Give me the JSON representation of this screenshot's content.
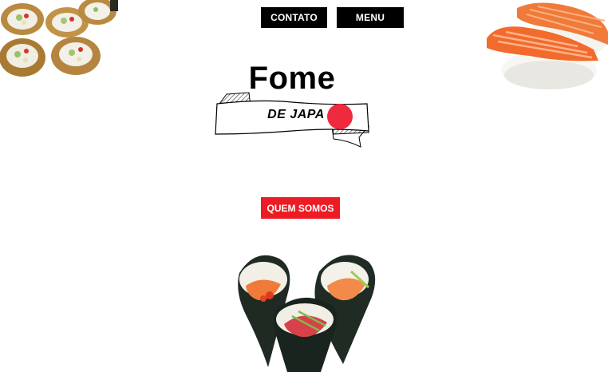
{
  "nav": {
    "contato_label": "CONTATO",
    "menu_label": "MENU"
  },
  "logo": {
    "title": "Fome",
    "subtitle": "DE JAPA"
  },
  "cta": {
    "quem_somos_label": "QUEM SOMOS"
  },
  "colors": {
    "nav_bg": "#000000",
    "accent_red": "#ed1c24",
    "text_white": "#ffffff"
  },
  "images": {
    "top_left": "sushi-rolls-image",
    "top_right": "salmon-nigiri-image",
    "bottom_center": "temaki-cones-image"
  }
}
